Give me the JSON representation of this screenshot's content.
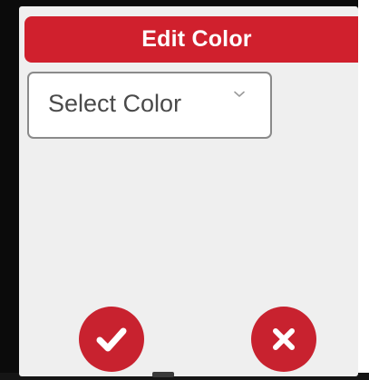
{
  "dialog": {
    "title": "Edit Color"
  },
  "color_select": {
    "placeholder": "Select Color",
    "icon": "chevron-down-icon"
  },
  "actions": {
    "confirm_icon": "check-icon",
    "cancel_icon": "close-icon"
  },
  "colors": {
    "accent": "#d0202d",
    "dialog_background": "#efefef",
    "frame": "#0b0b0b"
  }
}
